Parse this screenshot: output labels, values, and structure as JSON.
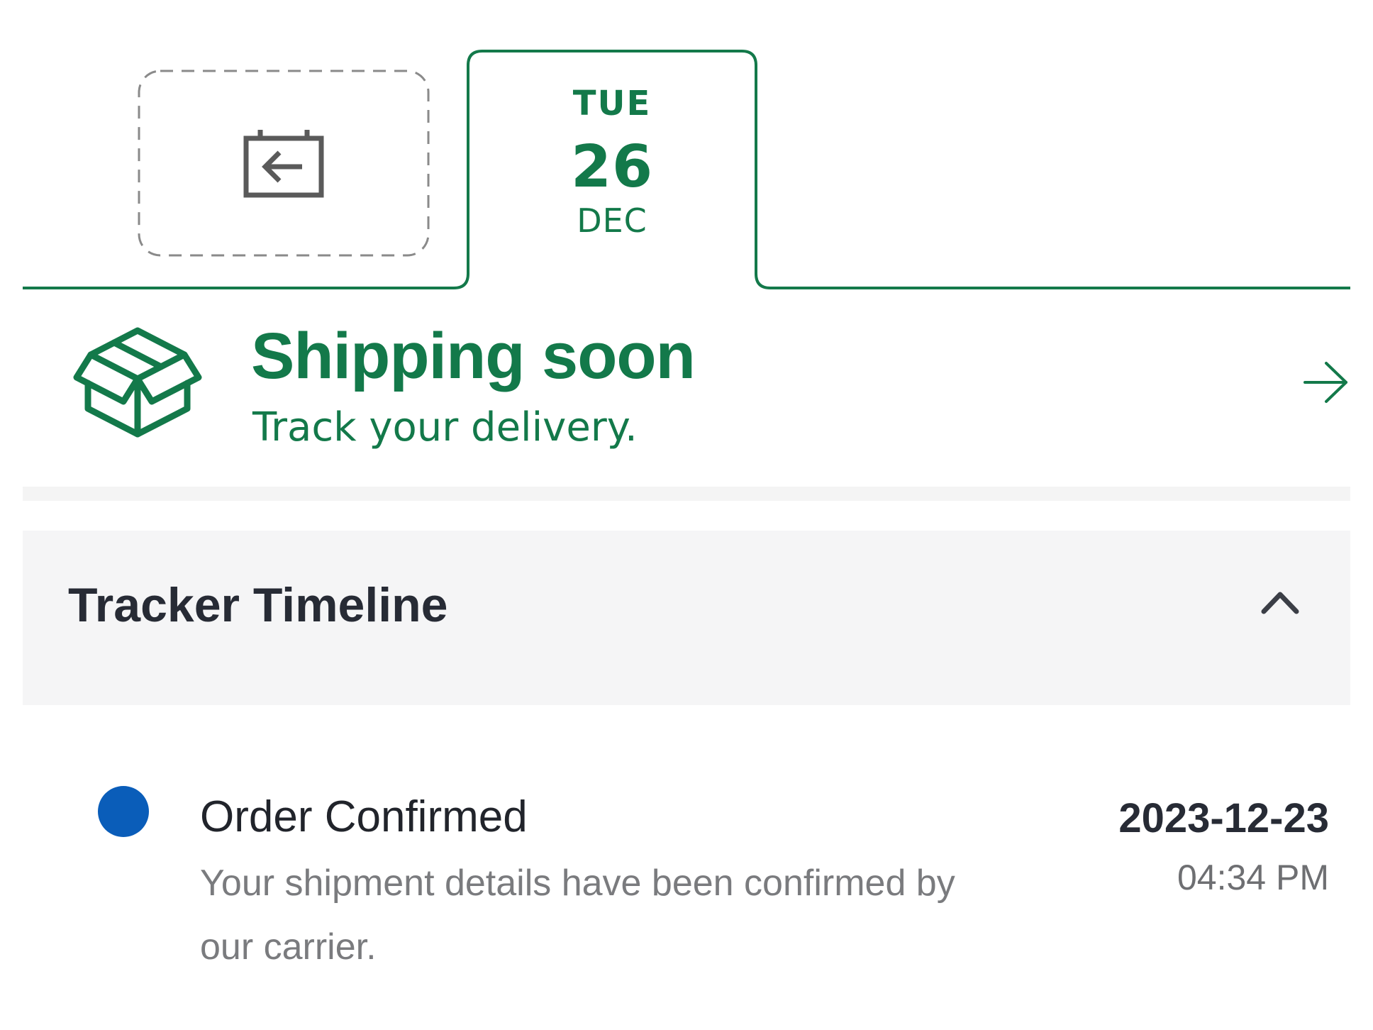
{
  "colors": {
    "brand_green": "#13794a",
    "timeline_dot": "#0a5db9",
    "header_bg": "#f5f5f6",
    "return_icon_gray": "#5a5a5a"
  },
  "date_tabs": {
    "return_tab_icon": "calendar-return-icon",
    "selected": {
      "weekday": "TUE",
      "day": "26",
      "month": "DEC"
    }
  },
  "shipping": {
    "icon": "package-box-icon",
    "title": "Shipping soon",
    "subtitle": "Track your delivery.",
    "arrow_icon": "arrow-right-icon"
  },
  "timeline": {
    "title": "Tracker Timeline",
    "toggle_icon": "chevron-up-icon",
    "events": [
      {
        "title": "Order Confirmed",
        "description": "Your shipment details have been confirmed by our carrier.",
        "date": "2023-12-23",
        "time": "04:34 PM"
      }
    ]
  }
}
